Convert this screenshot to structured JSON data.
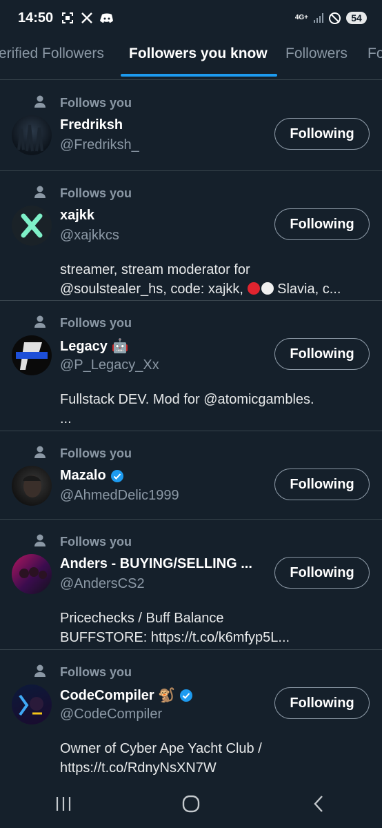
{
  "status_bar": {
    "time": "14:50",
    "network": "4G+",
    "battery": "54",
    "left_icons": [
      "screenshot-icon",
      "x-icon",
      "discord-icon"
    ]
  },
  "tabs": [
    {
      "label": "erified Followers",
      "active": false
    },
    {
      "label": "Followers you know",
      "active": true
    },
    {
      "label": "Followers",
      "active": false
    },
    {
      "label": "Fo",
      "active": false
    }
  ],
  "rows": [
    {
      "follows_label": "Follows you",
      "name": "Fredriksh",
      "handle": "@Fredriksh_",
      "verified": false,
      "button": "Following",
      "bio": []
    },
    {
      "follows_label": "Follows you",
      "name": "xajkk",
      "handle": "@xajkkcs",
      "verified": false,
      "button": "Following",
      "bio": [
        "streamer, stream moderator for",
        "@soulstealer_hs, code: xajkk,",
        " Slavia, c..."
      ]
    },
    {
      "follows_label": "Follows you",
      "name": "Legacy 🤖",
      "handle": "@P_Legacy_Xx",
      "verified": false,
      "button": "Following",
      "bio": [
        "Fullstack DEV. Mod for @atomicgambles.",
        "..."
      ]
    },
    {
      "follows_label": "Follows you",
      "name": "Mazalo",
      "handle": "@AhmedDelic1999",
      "verified": true,
      "button": "Following",
      "bio": []
    },
    {
      "follows_label": "Follows you",
      "name": "Anders - BUYING/SELLING ...",
      "handle": "@AndersCS2",
      "verified": false,
      "button": "Following",
      "bio": [
        "Pricechecks / Buff Balance",
        "BUFFSTORE: https://t.co/k6mfyp5L..."
      ]
    },
    {
      "follows_label": "Follows you",
      "name": "CodeCompiler 🐒",
      "handle": "@CodeCompiler",
      "verified": true,
      "button": "Following",
      "bio": [
        "Owner of Cyber Ape Yacht Club /",
        "https://t.co/RdnyNsXN7W"
      ]
    }
  ],
  "colors": {
    "background": "#15202b",
    "accent": "#1d9bf0",
    "secondary_text": "#8b98a5"
  }
}
